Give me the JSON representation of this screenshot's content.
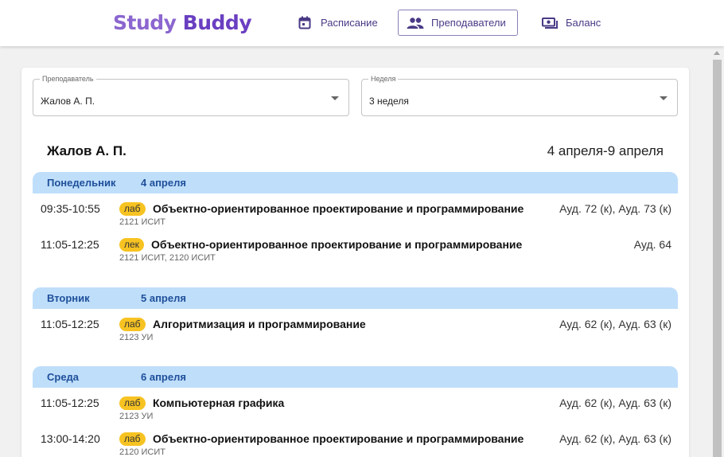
{
  "app": {
    "logo_part1": "Study",
    "logo_part2": "Buddy"
  },
  "nav": {
    "schedule": "Расписание",
    "teachers": "Преподаватели",
    "balance": "Баланс"
  },
  "filters": {
    "teacher_label": "Преподаватель",
    "teacher_value": "Жалов А. П.",
    "week_label": "Неделя",
    "week_value": "3 неделя"
  },
  "header": {
    "name": "Жалов А. П.",
    "range": "4 апреля-9 апреля"
  },
  "days": [
    {
      "name": "Понедельник",
      "date": "4 апреля",
      "lessons": [
        {
          "time": "09:35-10:55",
          "type": "лаб",
          "subject": "Объектно-ориентированное проектирование и программирование",
          "groups": "2121 ИСИТ",
          "room": "Ауд. 72 (к), Ауд. 73 (к)"
        },
        {
          "time": "11:05-12:25",
          "type": "лек",
          "subject": "Объектно-ориентированное проектирование и программирование",
          "groups": "2121 ИСИТ, 2120 ИСИТ",
          "room": "Ауд. 64"
        }
      ]
    },
    {
      "name": "Вторник",
      "date": "5 апреля",
      "lessons": [
        {
          "time": "11:05-12:25",
          "type": "лаб",
          "subject": "Алгоритмизация и программирование",
          "groups": "2123 УИ",
          "room": "Ауд. 62 (к), Ауд. 63 (к)"
        }
      ]
    },
    {
      "name": "Среда",
      "date": "6 апреля",
      "lessons": [
        {
          "time": "11:05-12:25",
          "type": "лаб",
          "subject": "Компьютерная графика",
          "groups": "2123 УИ",
          "room": "Ауд. 62 (к), Ауд. 63 (к)"
        },
        {
          "time": "13:00-14:20",
          "type": "лаб",
          "subject": "Объектно-ориентированное проектирование и программирование",
          "groups": "2120 ИСИТ",
          "room": "Ауд. 62 (к), Ауд. 63 (к)"
        }
      ]
    }
  ],
  "icons": {
    "schedule": "calendar-icon",
    "teachers": "people-icon",
    "balance": "cash-icon"
  },
  "colors": {
    "brand": "#6a3fc1",
    "day_header_bg": "#bfdefa",
    "day_header_text": "#1e4f9a",
    "type_badge": "#f7c322"
  }
}
